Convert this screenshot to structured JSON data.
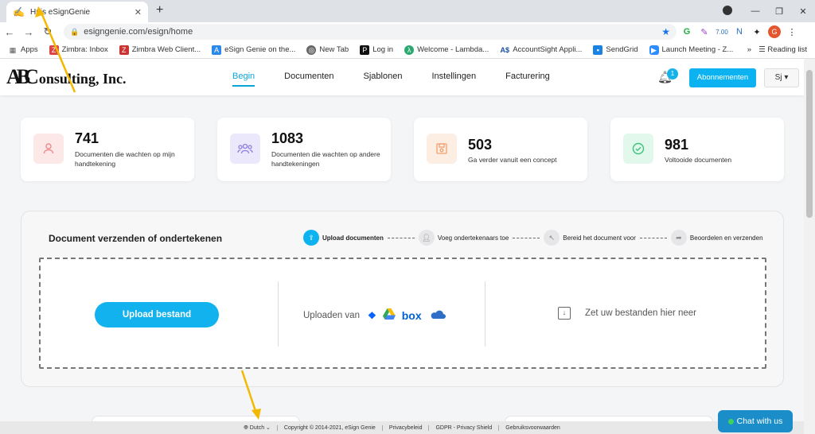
{
  "browser": {
    "tab_title": "Huis eSignGenie",
    "url": "esigngenie.com/esign/home",
    "new_tab": "+",
    "profile_initial": "G",
    "ext_badge": "7.00",
    "bookmarks": [
      "Apps",
      "Zimbra: Inbox",
      "Zimbra Web Client...",
      "eSign Genie on the...",
      "New Tab",
      "Log in",
      "Welcome - Lambda...",
      "AccountSight Appli...",
      "SendGrid",
      "Launch Meeting - Z..."
    ],
    "bookmarks_more": "»",
    "reading_list": "Reading list"
  },
  "header": {
    "logo_a": "A",
    "logo_b": "B",
    "logo_c": "C",
    "logo_rest": "onsulting, Inc.",
    "nav": [
      "Begin",
      "Documenten",
      "Sjablonen",
      "Instellingen",
      "Facturering"
    ],
    "notification_count": "1",
    "subscribe_label": "Abonnementen",
    "user_label": "Sj"
  },
  "stats": [
    {
      "value": "741",
      "label": "Documenten die wachten op mijn handtekening",
      "color": "#f08a8a",
      "bg": "#fde8e8",
      "icon": "user-icon"
    },
    {
      "value": "1083",
      "label": "Documenten die wachten op andere handtekeningen",
      "color": "#8d7ee0",
      "bg": "#ece8fb",
      "icon": "users-icon"
    },
    {
      "value": "503",
      "label": "Ga verder vanuit een concept",
      "color": "#f0a070",
      "bg": "#fdeee3",
      "icon": "save-icon"
    },
    {
      "value": "981",
      "label": "Voltooide documenten",
      "color": "#3cc47c",
      "bg": "#e3f8ec",
      "icon": "check-circle-icon"
    }
  ],
  "send": {
    "title": "Document verzenden of ondertekenen",
    "steps": [
      "Upload documenten",
      "Voeg ondertekenaars toe",
      "Bereid het document voor",
      "Beoordelen en verzenden"
    ],
    "upload_button": "Upload bestand",
    "upload_from": "Uploaden van",
    "box_label": "box",
    "drop_text": "Zet uw bestanden hier neer"
  },
  "footer": {
    "language": "Dutch",
    "copyright": "Copyright © 2014-2021, eSign Genie",
    "privacy": "Privacybeleid",
    "gdpr": "GDPR - Privacy Shield",
    "terms": "Gebruiksvoorwaarden"
  },
  "chat_label": "Chat with us",
  "colors": {
    "accent": "#0cb3f0",
    "chat": "#1b8ec9",
    "annotation": "#f5b800"
  }
}
